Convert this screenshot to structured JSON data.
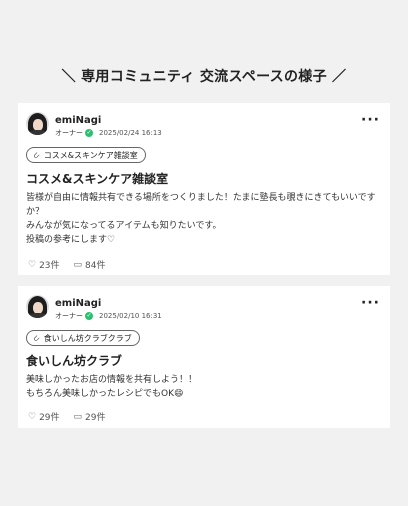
{
  "heading": "＼ 専用コミュニティ 交流スペースの様子 ／",
  "posts": [
    {
      "author": "emiNagi",
      "role": "オーナー",
      "date": "2025/02/24 16:13",
      "tag": "コスメ&スキンケア雑談室",
      "title": "コスメ&スキンケア雑談室",
      "body": "皆様が自由に情報共有できる場所をつくりました！たまに塾長も覗きにきてもいいですか？\nみんなが気になってるアイテムも知りたいです。\n投稿の参考にします♡",
      "likes": "23件",
      "comments": "84件"
    },
    {
      "author": "emiNagi",
      "role": "オーナー",
      "date": "2025/02/10 16:31",
      "tag": "食いしん坊クラブクラブ",
      "title": "食いしん坊クラブ",
      "body": "美味しかったお店の情報を共有しよう！！\nもちろん美味しかったレシピでもOK😄",
      "likes": "29件",
      "comments": "29件"
    }
  ],
  "icons": {
    "more": "more-icon",
    "check": "verified-check-icon",
    "tag": "paperclip-icon",
    "like": "heart-icon",
    "comment": "comment-icon"
  }
}
